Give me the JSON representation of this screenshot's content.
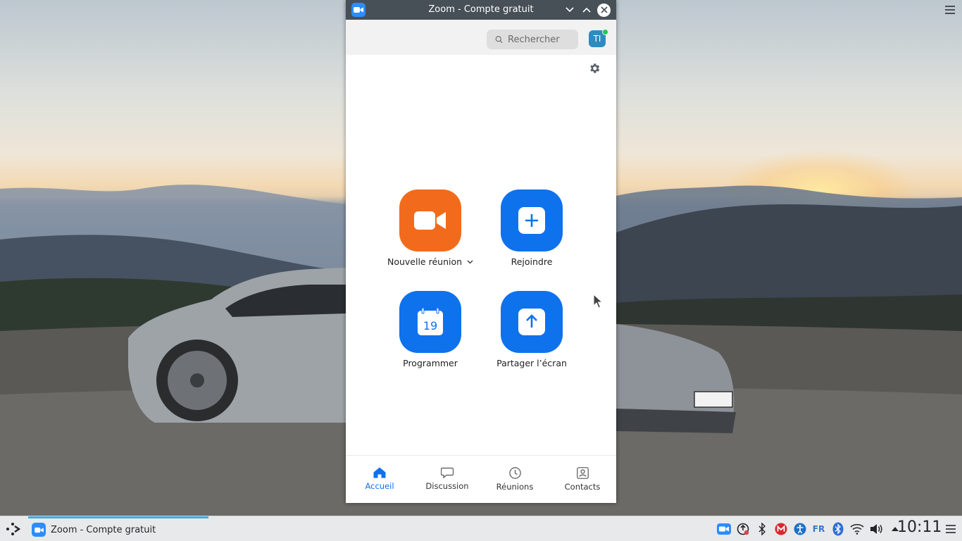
{
  "window": {
    "title": "Zoom - Compte gratuit"
  },
  "search": {
    "placeholder": "Rechercher"
  },
  "profile": {
    "initials": "TI",
    "status_color": "#24c75a"
  },
  "actions": {
    "new_meeting": {
      "label": "Nouvelle réunion",
      "icon": "video-camera-icon",
      "color": "#f26b1d"
    },
    "join": {
      "label": "Rejoindre",
      "icon": "plus-icon",
      "color": "#0e72ed"
    },
    "schedule": {
      "label": "Programmer",
      "icon": "calendar-icon",
      "day": "19",
      "color": "#0e72ed"
    },
    "share_screen": {
      "label": "Partager l’écran",
      "icon": "upload-arrow-icon",
      "color": "#0e72ed"
    }
  },
  "nav": {
    "items": [
      {
        "label": "Accueil",
        "icon": "home-icon",
        "active": true
      },
      {
        "label": "Discussion",
        "icon": "chat-icon",
        "active": false
      },
      {
        "label": "Réunions",
        "icon": "clock-icon",
        "active": false
      },
      {
        "label": "Contacts",
        "icon": "contact-card-icon",
        "active": false
      }
    ],
    "active_color": "#0e72ed"
  },
  "taskbar": {
    "task_label": "Zoom - Compte gratuit",
    "language": "FR",
    "clock": "10:11",
    "tray_icons": [
      "zoom-tray-icon",
      "update-icon",
      "bluetooth-icon",
      "mega-icon",
      "accessibility-icon",
      "language-icon",
      "bluetooth-icon",
      "wifi-icon",
      "volume-icon",
      "expand-tray-icon"
    ]
  }
}
